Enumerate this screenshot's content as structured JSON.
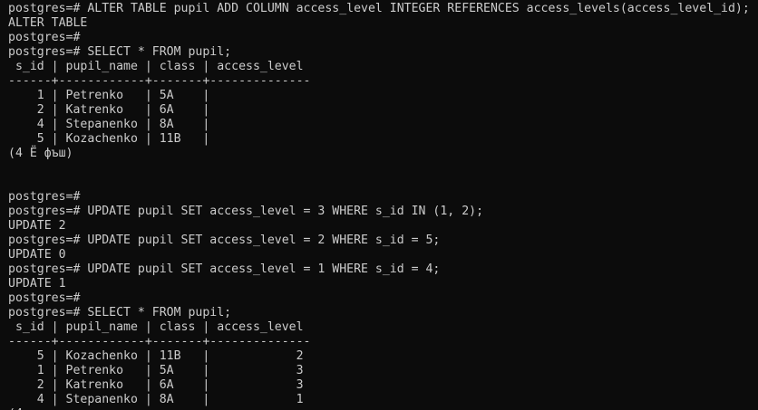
{
  "terminal": {
    "lines": [
      "postgres=# ALTER TABLE pupil ADD COLUMN access_level INTEGER REFERENCES access_levels(access_level_id);",
      "ALTER TABLE",
      "postgres=#",
      "postgres=# SELECT * FROM pupil;",
      " s_id | pupil_name | class | access_level",
      "------+------------+-------+--------------",
      "    1 | Petrenko   | 5A    |",
      "    2 | Katrenko   | 6A    |",
      "    4 | Stepanenko | 8A    |",
      "    5 | Kozachenko | 11B   |",
      "(4 Ё фъш)",
      "",
      "",
      "postgres=#",
      "postgres=# UPDATE pupil SET access_level = 3 WHERE s_id IN (1, 2);",
      "UPDATE 2",
      "postgres=# UPDATE pupil SET access_level = 2 WHERE s_id = 5;",
      "UPDATE 0",
      "postgres=# UPDATE pupil SET access_level = 1 WHERE s_id = 4;",
      "UPDATE 1",
      "postgres=#",
      "postgres=# SELECT * FROM pupil;",
      " s_id | pupil_name | class | access_level",
      "------+------------+-------+--------------",
      "    5 | Kozachenko | 11B   |            2",
      "    1 | Petrenko   | 5A    |            3",
      "    2 | Katrenko   | 6A    |            3",
      "    4 | Stepanenko | 8A    |            1",
      "(4"
    ]
  }
}
